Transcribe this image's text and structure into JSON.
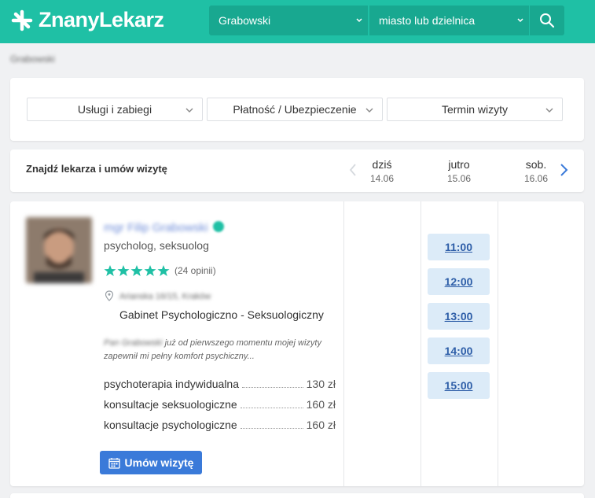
{
  "header": {
    "brand": "ZnanyLekarz",
    "search_name_value": "Grabowski",
    "search_location_placeholder": "miasto lub dzielnica"
  },
  "breadcrumb": "Grabowski",
  "filters": [
    {
      "label": "Usługi i zabiegi"
    },
    {
      "label": "Płatność / Ubezpieczenie"
    },
    {
      "label": "Termin wizyty"
    }
  ],
  "dates": {
    "title": "Znajdź lekarza i umów wizytę",
    "days": [
      {
        "name": "dziś",
        "date": "14.06"
      },
      {
        "name": "jutro",
        "date": "15.06"
      },
      {
        "name": "sob.",
        "date": "16.06"
      }
    ]
  },
  "doctor": {
    "name": "mgr Filip Grabowski",
    "specialty": "psycholog, seksuolog",
    "rating": 5,
    "reviews": "(24 opinii)",
    "address": "Arianska 16/15, Kraków",
    "office": "Gabinet Psychologiczno - Seksuologiczny",
    "review_author": "Pan Grabowski",
    "review_text": " już od pierwszego momentu mojej wizyty zapewnił mi pełny komfort psychiczny...",
    "prices": [
      {
        "service": "psychoterapia indywidualna",
        "price": "130 zł"
      },
      {
        "service": "konsultacje seksuologiczne",
        "price": "160 zł"
      },
      {
        "service": "konsultacje psychologiczne",
        "price": "160 zł"
      }
    ],
    "book_label": "Umów wizytę",
    "slots": [
      "11:00",
      "12:00",
      "13:00",
      "14:00",
      "15:00"
    ]
  },
  "colors": {
    "brand": "#1fc0a5",
    "accent": "#3a7ad9",
    "slot_bg": "#dcebf8"
  }
}
